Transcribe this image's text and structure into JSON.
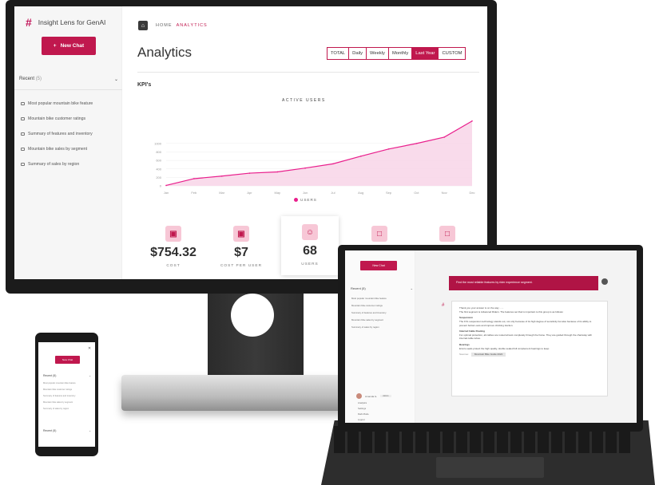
{
  "desktop": {
    "brand": "Insight Lens for GenAI",
    "new_chat": "New Chat",
    "recent_label": "Recent",
    "recent_count": "(5)",
    "recent_items": [
      "Most popular mountain bike feature",
      "Mountain bike customer ratings",
      "Summary of features and inventory",
      "Mountain bike sales by segment",
      "Summary of sales by region"
    ],
    "breadcrumb": {
      "home": "HOME",
      "current": "ANALYTICS"
    },
    "title": "Analytics",
    "filters": [
      "TOTAL",
      "Daily",
      "Weekly",
      "Monthly",
      "Last Year",
      "CUSTOM"
    ],
    "active_filter": "Last Year",
    "kpis_label": "KPI's",
    "cards": [
      {
        "icon": "money-icon",
        "value": "$754.32",
        "label": "COST"
      },
      {
        "icon": "money-icon",
        "value": "$7",
        "label": "COST PER USER"
      },
      {
        "icon": "user-icon",
        "value": "68",
        "label": "USERS"
      },
      {
        "icon": "chat-icon",
        "value": "",
        "label": ""
      },
      {
        "icon": "chat-icon",
        "value": "",
        "label": ""
      }
    ]
  },
  "chart_data": {
    "type": "area",
    "title": "ACTIVE USERS",
    "x": [
      "Jan",
      "Feb",
      "Mar",
      "Apr",
      "May",
      "Jun",
      "Jul",
      "Aug",
      "Sep",
      "Oct",
      "Nov",
      "Dec"
    ],
    "series": [
      {
        "name": "USERS",
        "values": [
          10,
          170,
          230,
          300,
          330,
          420,
          520,
          700,
          870,
          1000,
          1150,
          1530
        ]
      }
    ],
    "ylim": [
      0,
      1600
    ],
    "yticks": [
      "0",
      "200",
      "400",
      "600",
      "800",
      "1000"
    ],
    "grid": true,
    "legend": "bottom",
    "color": "#e91e8c"
  },
  "tablet": {
    "new_chat": "New Chat",
    "recent_label": "Recent",
    "recent_count": "(5)",
    "user_message": "Find the most reliable features by rider experience segment.",
    "bot_intro": "Thank you your answer is on the way ......",
    "bot_para": "The first segment is Advanced Riders. The features set that is important to this group is as follows:",
    "sections": [
      {
        "h": "Suspension",
        "t": "The FXL suspension technology stands out, not only because of its high degree of sensitivity but also because of its ability to prevent bottom-outs and improve climbing traction."
      },
      {
        "h": "Internal Cable Routing",
        "t": "For optimal protection, all cables are routed almost completely through the frame. They are guided through the chainstay with internal cable tubes."
      },
      {
        "h": "Bearings",
        "t": "Enviro seals protect the high quality, double sealed full complement bearings to keep"
      }
    ],
    "sources_label": "Sources:",
    "source_tag": "Mountain Bike Guide 2024",
    "user_name": "Amanda G.",
    "user_badge": "Admin",
    "menu": [
      "Analytics",
      "Settings",
      "Dark Mode",
      "Logout"
    ]
  },
  "phone": {
    "new_chat": "New Chat",
    "recent_label": "Recent",
    "recent_count": "(5)",
    "recent2_label": "Recent",
    "recent2_count": "(5)"
  }
}
